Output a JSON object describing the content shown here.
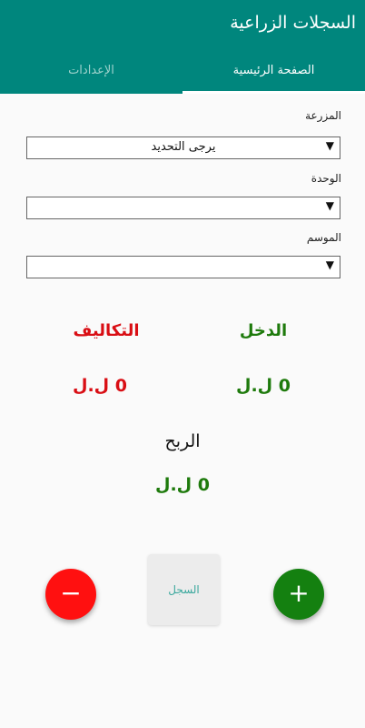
{
  "header": {
    "title": "السجلات الزراعية"
  },
  "tabs": {
    "home": "الصفحة الرئيسية",
    "settings": "الإعدادات"
  },
  "form": {
    "farm_label": "المزرعة",
    "farm_value": "يرجى التحديد",
    "unit_label": "الوحدة",
    "unit_value": "",
    "season_label": "الموسم",
    "season_value": ""
  },
  "stats": {
    "income_label": "الدخل",
    "income_value": "0 ل.ل",
    "costs_label": "التكاليف",
    "costs_value": "0 ل.ل",
    "profit_label": "الربح",
    "profit_value": "0 ل.ل"
  },
  "actions": {
    "log_label": "السجل",
    "add_symbol": "+",
    "subtract_symbol": "−"
  },
  "colors": {
    "primary": "#00867d",
    "income": "#1e7a0c",
    "costs": "#d90e14",
    "add": "#148010",
    "subtract": "#ff1010"
  }
}
